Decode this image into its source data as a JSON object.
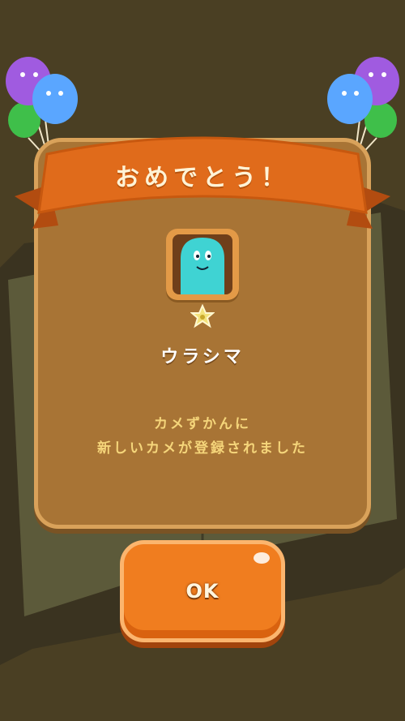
{
  "dialog": {
    "title": "おめでとう！",
    "turtle_name": "ウラシマ",
    "message_line1": "カメずかんに",
    "message_line2": "新しいカメが登録されました",
    "ok_label": "OK"
  },
  "icons": {
    "portrait": "turtle-character-icon",
    "rarity": "star-icon",
    "decoration": "balloon-icon"
  },
  "colors": {
    "background": "#4a3f23",
    "panel": "#a87435",
    "ribbon": "#e06b1b",
    "character": "#3fd3d3",
    "button": "#f07d1f",
    "message_text": "#f5d57a"
  }
}
